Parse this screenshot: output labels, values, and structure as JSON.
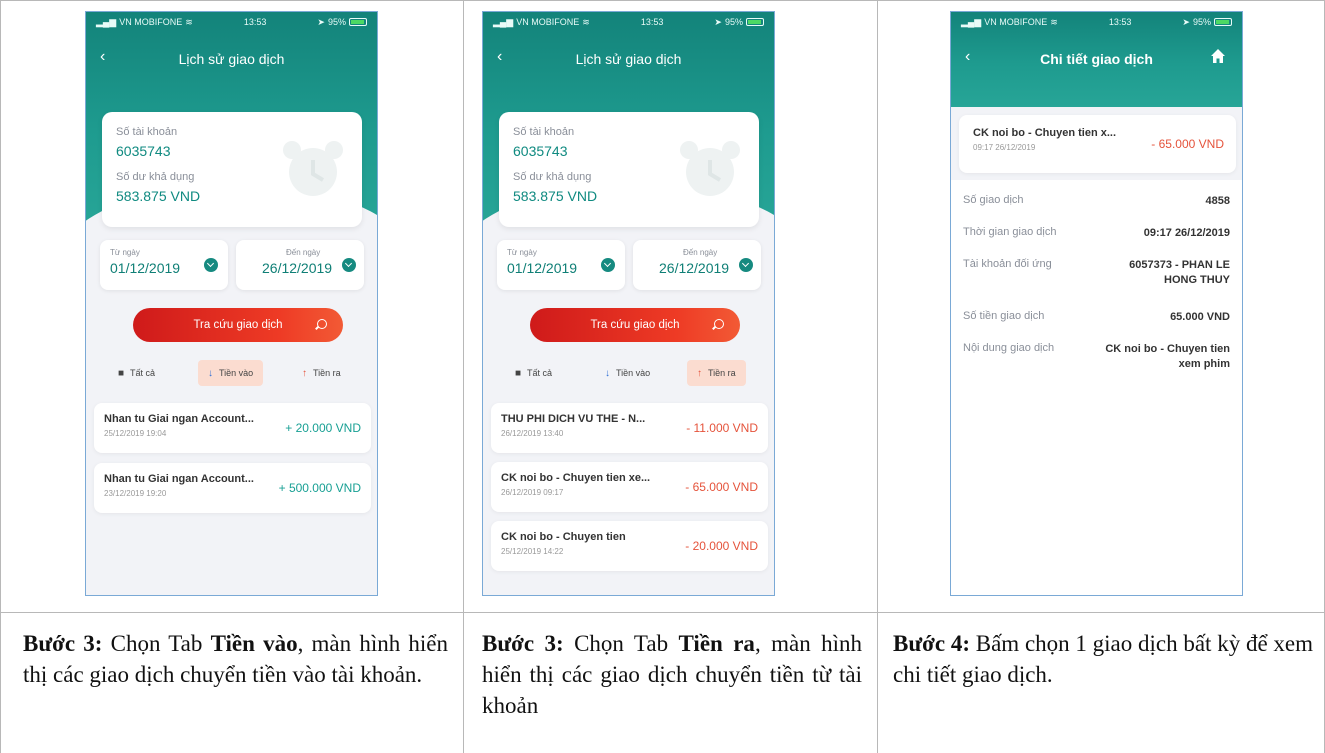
{
  "status_bar": {
    "carrier": "VN MOBIFONE",
    "time": "13:53",
    "battery": "95%"
  },
  "screens": [
    {
      "title": "Lịch sử giao dịch",
      "account_label": "Số tài khoản",
      "account_number": "6035743",
      "balance_label": "Số dư khả dụng",
      "balance": "583.875  VND",
      "from_label": "Từ ngày",
      "from_date": "01/12/2019",
      "to_label": "Đến ngày",
      "to_date": "26/12/2019",
      "search_button": "Tra cứu giao dịch",
      "tabs": [
        "Tất cả",
        "Tiền vào",
        "Tiền ra"
      ],
      "active_tab": "Tiền vào",
      "transactions": [
        {
          "name": "Nhan tu Giai ngan Account...",
          "date": "25/12/2019 19:04",
          "amount": "+ 20.000  VND"
        },
        {
          "name": "Nhan tu Giai ngan Account...",
          "date": "23/12/2019 19:20",
          "amount": "+ 500.000  VND"
        }
      ]
    },
    {
      "title": "Lịch sử giao dịch",
      "account_label": "Số tài khoản",
      "account_number": "6035743",
      "balance_label": "Số dư khả dụng",
      "balance": "583.875  VND",
      "from_label": "Từ ngày",
      "from_date": "01/12/2019",
      "to_label": "Đến ngày",
      "to_date": "26/12/2019",
      "search_button": "Tra cứu giao dịch",
      "tabs": [
        "Tất cả",
        "Tiền vào",
        "Tiền ra"
      ],
      "active_tab": "Tiền ra",
      "transactions": [
        {
          "name": "THU PHI DICH VU THE - N...",
          "date": "26/12/2019 13:40",
          "amount": "- 11.000  VND"
        },
        {
          "name": "CK noi bo - Chuyen tien xe...",
          "date": "26/12/2019 09:17",
          "amount": "- 65.000  VND"
        },
        {
          "name": "CK noi bo - Chuyen tien",
          "date": "25/12/2019 14:22",
          "amount": "- 20.000  VND"
        }
      ]
    },
    {
      "title": "Chi tiết giao dịch",
      "summary": {
        "name": "CK noi bo - Chuyen tien x...",
        "date": "09:17 26/12/2019",
        "amount": "- 65.000  VND"
      },
      "rows": [
        {
          "label": "Số giao dịch",
          "value": "4858"
        },
        {
          "label": "Thời gian giao dịch",
          "value": "09:17 26/12/2019"
        },
        {
          "label": "Tài khoản đối ứng",
          "value": "6057373 - PHAN LE HONG THUY"
        },
        {
          "label": "Số tiền giao dịch",
          "value": "65.000  VND"
        },
        {
          "label": "Nội dung giao dịch",
          "value": "CK noi bo - Chuyen tien xem phim"
        }
      ]
    }
  ],
  "captions": [
    {
      "step": "Bước 3:",
      "pre": " Chọn Tab ",
      "bold": "Tiền vào",
      "post": ", màn hình hiển thị các giao dịch chuyển tiền vào tài khoản."
    },
    {
      "step": "Bước 3:",
      "pre": " Chọn Tab ",
      "bold": "Tiền ra",
      "post": ", màn hình hiển thị các giao dịch chuyển tiền từ tài khoản"
    },
    {
      "step": "Bước 4:",
      "pre": " Bấm chọn 1 giao dịch bất kỳ để xem chi tiết giao dịch.",
      "bold": "",
      "post": ""
    }
  ],
  "colors": {
    "teal": "#1e9b8f",
    "red_button": "#e53325",
    "incoming": "#18a094",
    "outgoing": "#e5533b",
    "active_tab": "#fbdcd0"
  }
}
